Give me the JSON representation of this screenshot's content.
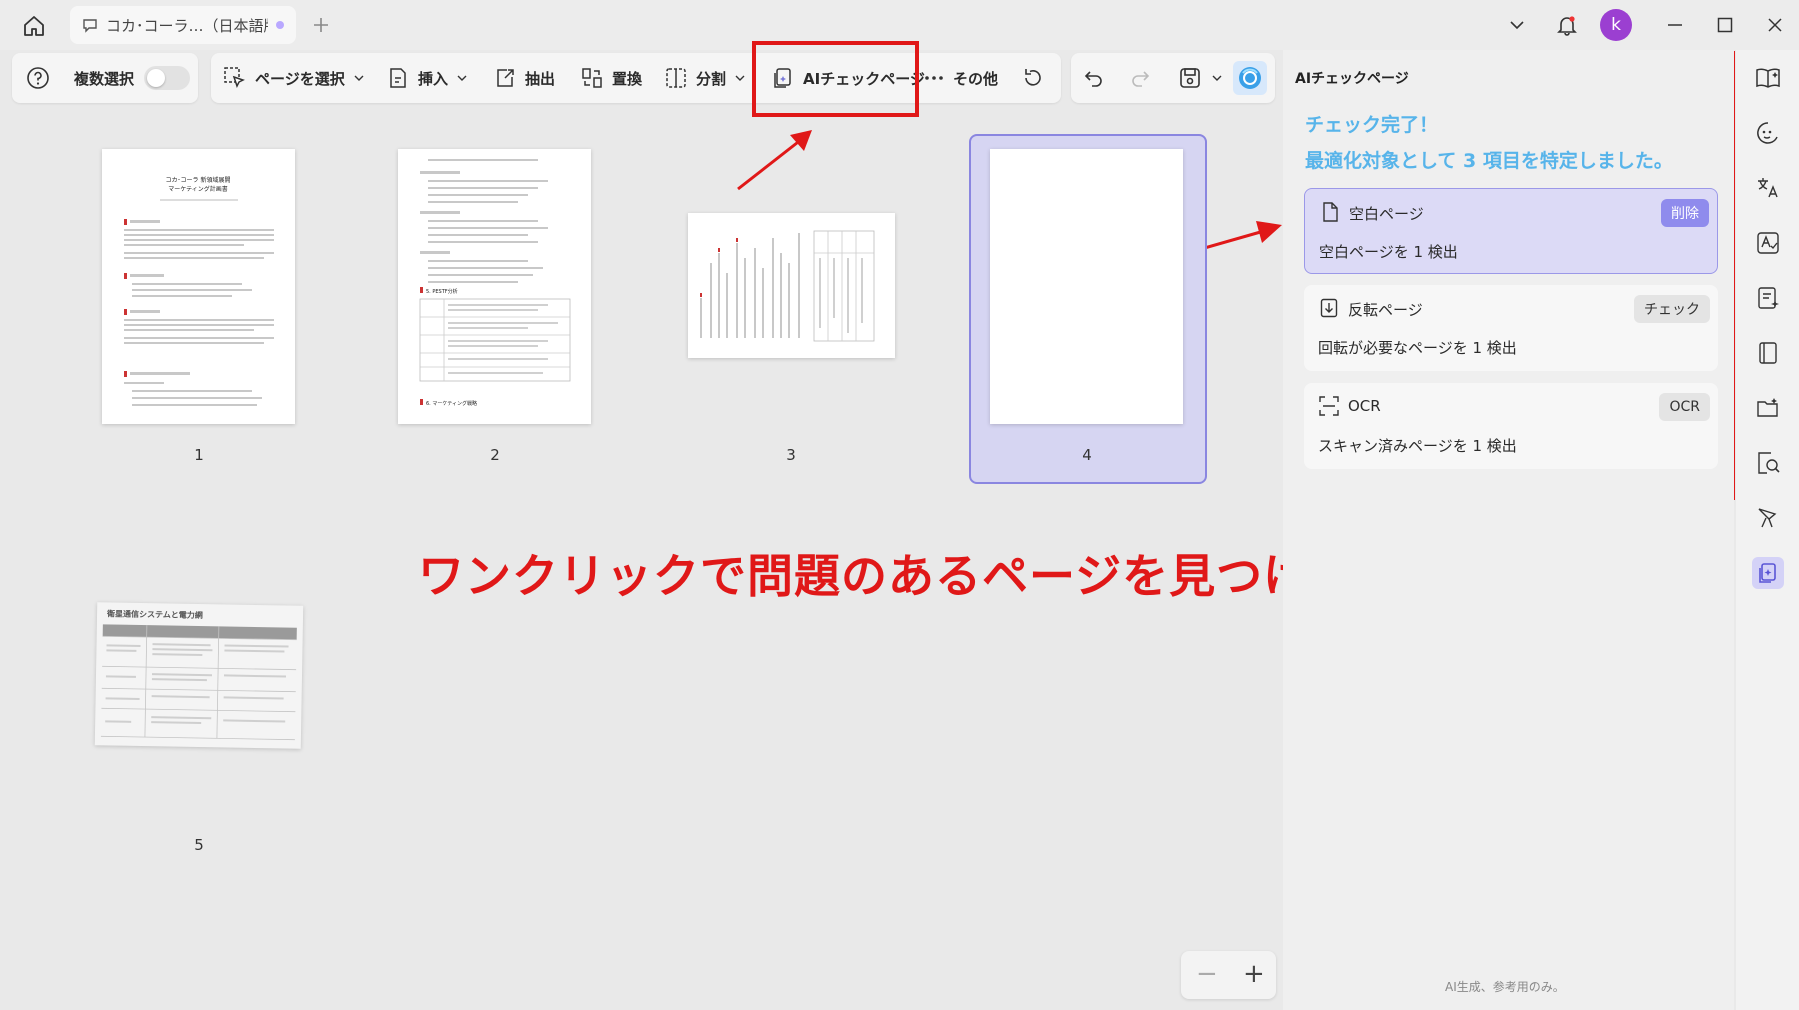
{
  "titlebar": {
    "tab_title": "コカ･コーラ…（日本語版）",
    "avatar_letter": "k"
  },
  "toolbar": {
    "multi_select": "複数選択",
    "select_page": "ページを選択",
    "insert": "挿入",
    "extract": "抽出",
    "replace": "置換",
    "split": "分割",
    "ai_check": "AIチェックページ",
    "more": "その他"
  },
  "pages": [
    {
      "label": "1"
    },
    {
      "label": "2"
    },
    {
      "label": "3"
    },
    {
      "label": "4"
    },
    {
      "label": "5"
    }
  ],
  "thumb_text": {
    "p1_title1": "コカ･コーラ 新領域展開",
    "p1_title2": "マーケティング計画書",
    "p2_heading1": "5. PESTF分析",
    "p2_heading2": "6. マーケティング戦略",
    "p5_title": "衛星通信システムと電力網"
  },
  "panel": {
    "title": "AIチェックページ",
    "done": "チェック完了！",
    "summary": "最適化対象として 3 項目を特定しました。",
    "cards": [
      {
        "title": "空白ページ",
        "desc": "空白ページを 1 検出",
        "button": "削除"
      },
      {
        "title": "反転ページ",
        "desc": "回転が必要なページを 1 検出",
        "button": "チェック"
      },
      {
        "title": "OCR",
        "desc": "スキャン済みページを 1 検出",
        "button": "OCR"
      }
    ],
    "footnote": "AI生成、参考用のみ。"
  },
  "annotation": {
    "caption": "ワンクリックで問題のあるページを見つけて、すぐに対応"
  },
  "colors": {
    "accent": "#8f8bed",
    "highlight_text": "#57b4ea",
    "annotation_red": "#e01818"
  }
}
